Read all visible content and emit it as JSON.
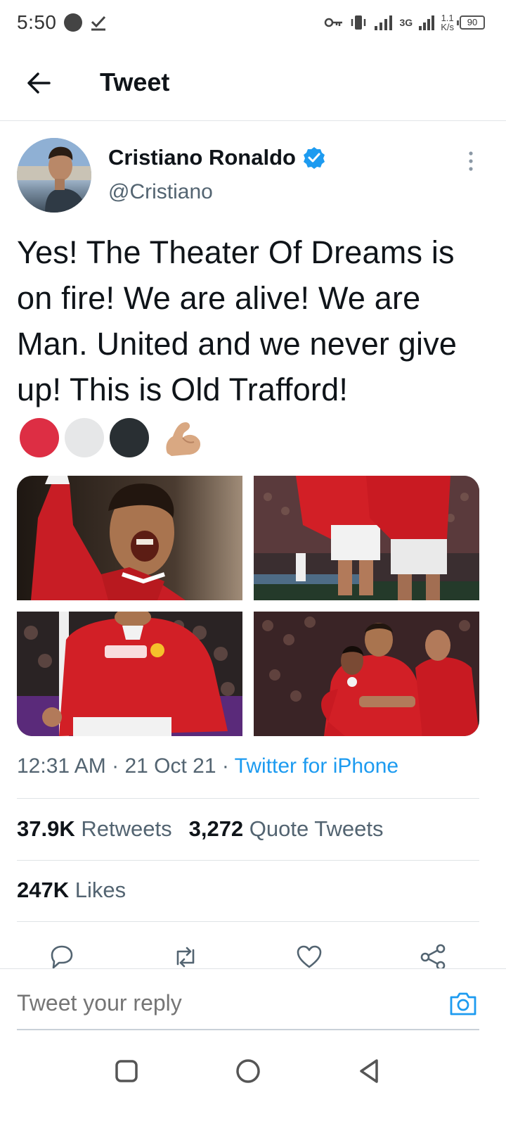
{
  "status_bar": {
    "time": "5:50",
    "network": "3G",
    "speed_value": "1.1",
    "speed_unit": "K/s",
    "battery": "90"
  },
  "header": {
    "title": "Tweet"
  },
  "author": {
    "name": "Cristiano Ronaldo",
    "handle": "@Cristiano"
  },
  "tweet": {
    "text": "Yes! The Theater Of Dreams is on fire! We are alive! We are Man. United and we never give up! This is Old Trafford!",
    "emojis": [
      {
        "name": "red-circle-emoji",
        "color": "#dd2e44"
      },
      {
        "name": "white-circle-emoji",
        "color": "#e6e7e8"
      },
      {
        "name": "black-circle-emoji",
        "color": "#292f33"
      },
      {
        "name": "flexed-biceps-emoji",
        "color": "#d9a882"
      }
    ],
    "photos": [
      "celebration-photo",
      "players-running-photo",
      "celebration-goal-photo",
      "team-hug-photo"
    ],
    "time": "12:31 AM",
    "date": "21 Oct 21",
    "separator": "·",
    "source": "Twitter for iPhone"
  },
  "stats": {
    "retweets_count": "37.9K",
    "retweets_label": "Retweets",
    "quotes_count": "3,272",
    "quotes_label": "Quote Tweets",
    "likes_count": "247K",
    "likes_label": "Likes"
  },
  "reply": {
    "placeholder": "Tweet your reply"
  },
  "colors": {
    "accent": "#1d9bf0",
    "text": "#0f1419",
    "muted": "#536471"
  }
}
